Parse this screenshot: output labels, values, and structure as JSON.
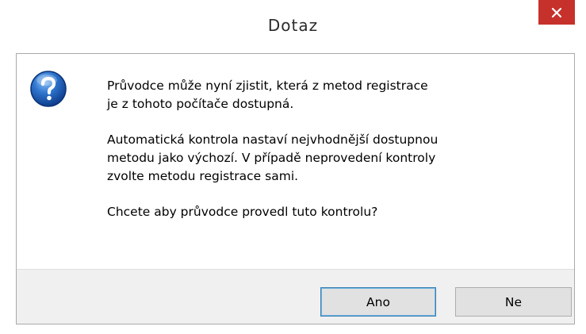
{
  "dialog": {
    "title": "Dotaz",
    "close_symbol": "×",
    "icon": "question-icon",
    "message": {
      "line1": "Průvodce může nyní zjistit, která z metod registrace",
      "line2": "je z tohoto počítače dostupná.",
      "line3": "Automatická kontrola nastaví nejvhodnější dostupnou",
      "line4": "metodu jako výchozí. V případě neprovedení kontroly",
      "line5": "zvolte metodu registrace sami.",
      "line6": "Chcete aby průvodce provedl tuto kontrolu?"
    },
    "buttons": {
      "yes_label": "Ano",
      "no_label": "Ne"
    }
  },
  "colors": {
    "close_button": "#c7312b",
    "icon_blue": "#1f5fb7",
    "footer": "#f0f0f0",
    "default_button_border": "#3c7fb1"
  }
}
